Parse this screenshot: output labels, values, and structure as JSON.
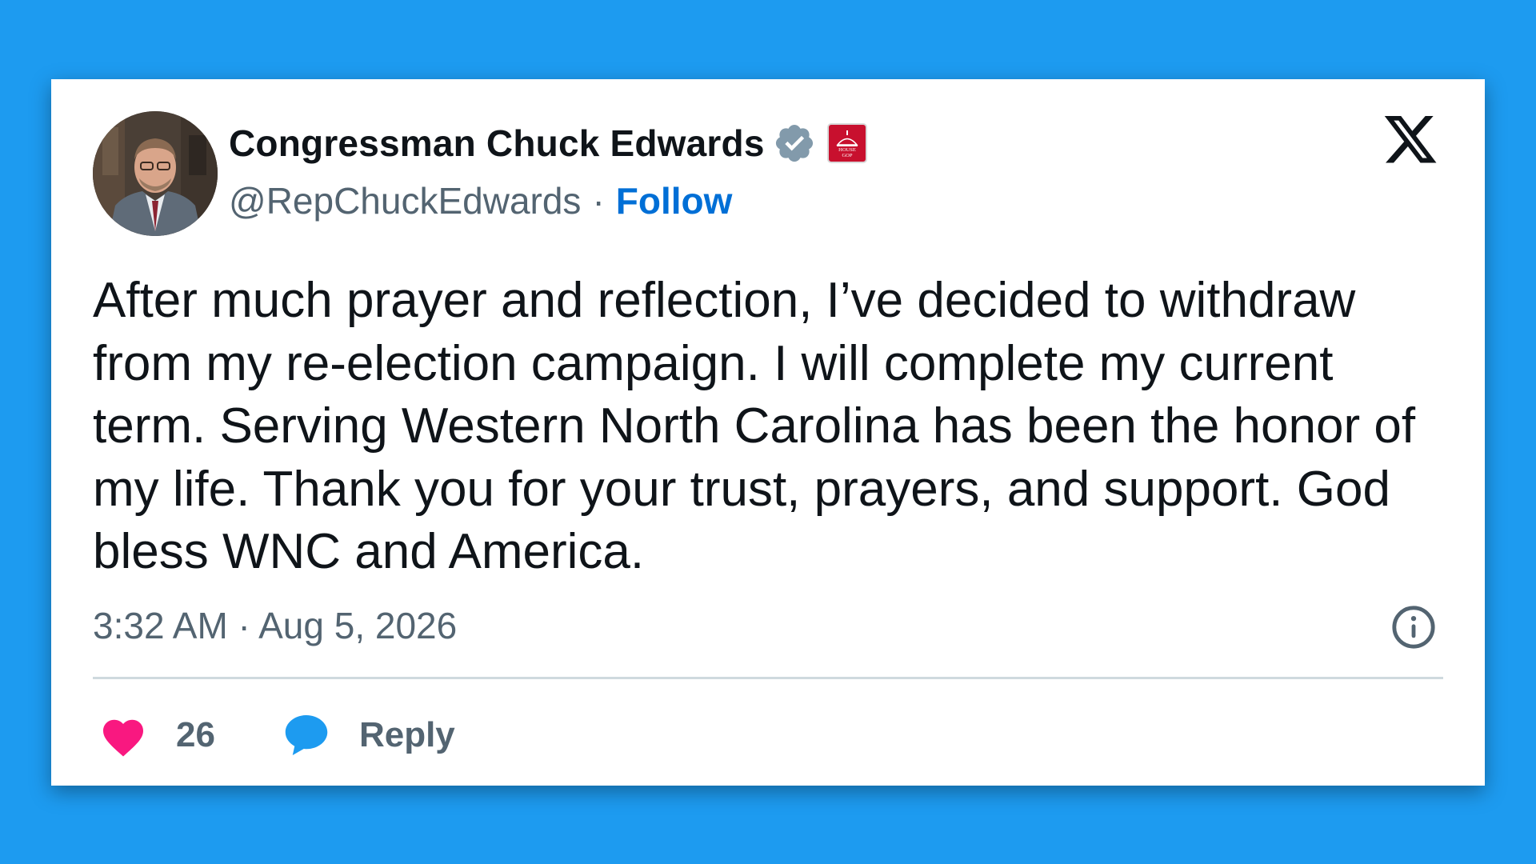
{
  "tweet": {
    "author": {
      "display_name": "Congressman Chuck Edwards",
      "handle": "@RepChuckEdwards",
      "separator": "·",
      "follow_label": "Follow",
      "verified_badge_icon": "verified-gray-badge-icon",
      "affiliation_badge_icon": "house-gop-badge-icon",
      "affiliation_badge_text": [
        "HOUSE",
        "GOP"
      ]
    },
    "text": "After much prayer and reflection, I’ve decided to withdraw from my re-election campaign. I will complete my current term. Serving Western North Carolina has been the honor of my life. Thank you for your trust, prayers, and support. God bless WNC and America.",
    "timestamp": "3:32 AM · Aug 5, 2026",
    "like_count": "26",
    "reply_label": "Reply"
  },
  "icons": {
    "platform_logo": "x-logo-icon",
    "info": "info-icon",
    "like": "heart-icon",
    "reply": "speech-bubble-icon"
  },
  "colors": {
    "background": "#1d9bf0",
    "card": "#ffffff",
    "text_primary": "#0f1419",
    "text_secondary": "#536471",
    "follow_link": "#006fd6",
    "verified_gray": "#829aab",
    "like_pink": "#f91880",
    "reply_blue": "#1d9bf0",
    "badge_red": "#c8102e"
  }
}
